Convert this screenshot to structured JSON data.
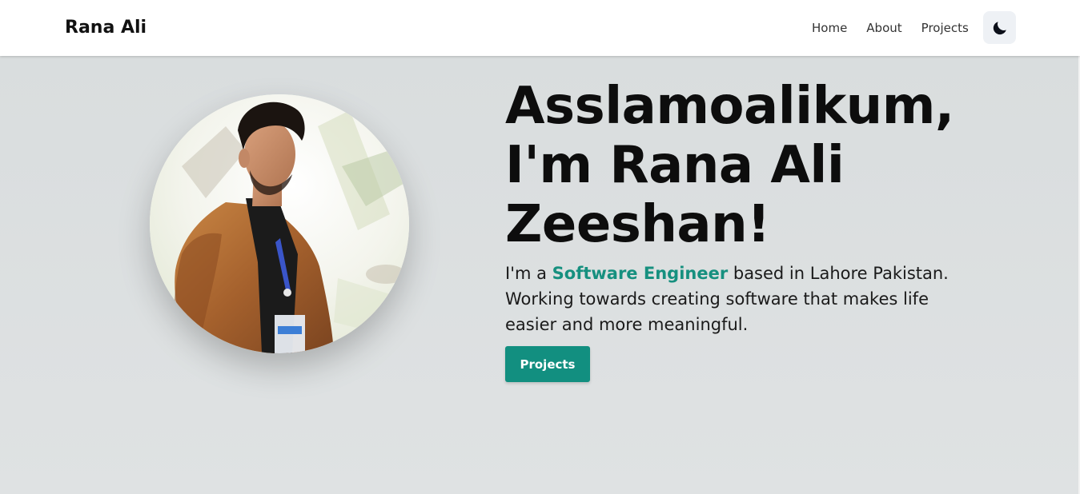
{
  "navbar": {
    "brand": "Rana Ali",
    "links": [
      {
        "label": "Home"
      },
      {
        "label": "About"
      },
      {
        "label": "Projects"
      }
    ],
    "theme_toggle_icon": "moon-icon"
  },
  "hero": {
    "heading_lines": [
      "Asslamoalikum,",
      "I'm Rana Ali",
      "Zeeshan!"
    ],
    "intro_prefix": "I'm a ",
    "intro_highlight": "Software Engineer",
    "intro_suffix": " based in Lahore Pakistan. Working towards creating software that makes life easier and more meaningful.",
    "cta_label": "Projects",
    "accent_color": "#128f80",
    "avatar_icon": "profile-photo"
  }
}
